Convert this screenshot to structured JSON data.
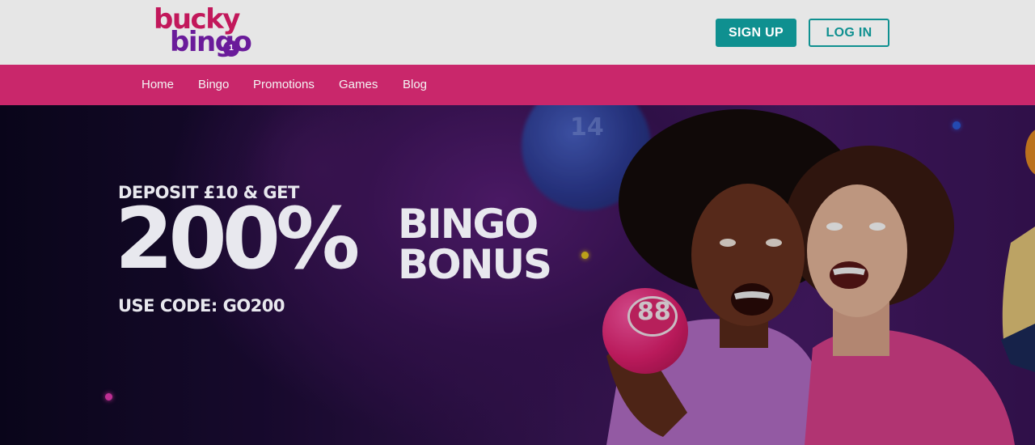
{
  "brand": {
    "logo_line1": "bucky",
    "logo_line2": "bingo",
    "logo_ball": "1",
    "primary_color": "#c9276b",
    "secondary_color": "#6a1b9a",
    "accent_color": "#0f9090"
  },
  "header": {
    "signup_label": "SIGN UP",
    "login_label": "LOG IN"
  },
  "nav": {
    "items": [
      {
        "label": "Home"
      },
      {
        "label": "Bingo"
      },
      {
        "label": "Promotions"
      },
      {
        "label": "Games"
      },
      {
        "label": "Blog"
      }
    ]
  },
  "hero": {
    "line1": "DEPOSIT £10 & GET",
    "percent": "200%",
    "bonus_line1": "BINGO",
    "bonus_line2": "BONUS",
    "code_line": "USE CODE: GO200",
    "ball_number": "88",
    "blue_ball_number": "14"
  }
}
